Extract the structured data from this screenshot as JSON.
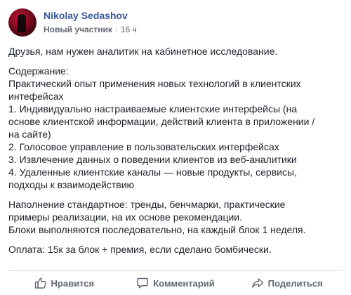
{
  "post": {
    "author": "Nikolay Sedashov",
    "role": "Новый участник",
    "separator": "·",
    "time": "16 ч",
    "lines": {
      "intro": "Друзья, нам нужен аналитик на кабинетное исследование.",
      "contents_heading": "Содержание:",
      "c1": "Практический опыт применения новых технологий в клиентских",
      "c2": "интефейсах",
      "c3": "1. Индивидуально настраиваемые клиентские интерфейсы (на",
      "c4": "основе клиентской информации, действий клиента в приложении /",
      "c5": "на сайте)",
      "c6": "2. Голосовое управление в пользовательских интерфейсах",
      "c7": "3. Извлечение данных о поведении клиентов из веб-аналитики",
      "c8": "4. Удаленные клиентские каналы — новые продукты, сервисы,",
      "c9": "подходы к взаимодействию",
      "f1": "Наполнение стандартное: тренды, бенчмарки, практические",
      "f2": "примеры реализации, на их основе рекомендации.",
      "f3": "Блоки выполняются последовательно, на каждый блок 1 неделя.",
      "pay": "Оплата: 15к за блок + премия, если сделано бомбически."
    }
  },
  "actions": {
    "like": {
      "label": "Нравится",
      "icon": "thumbs-up-icon"
    },
    "comment": {
      "label": "Комментарий",
      "icon": "comment-icon"
    },
    "share": {
      "label": "Поделиться",
      "icon": "share-icon"
    }
  },
  "colors": {
    "author": "#385898",
    "meta": "#606770",
    "text": "#1d2129",
    "divider": "#dadde1"
  }
}
